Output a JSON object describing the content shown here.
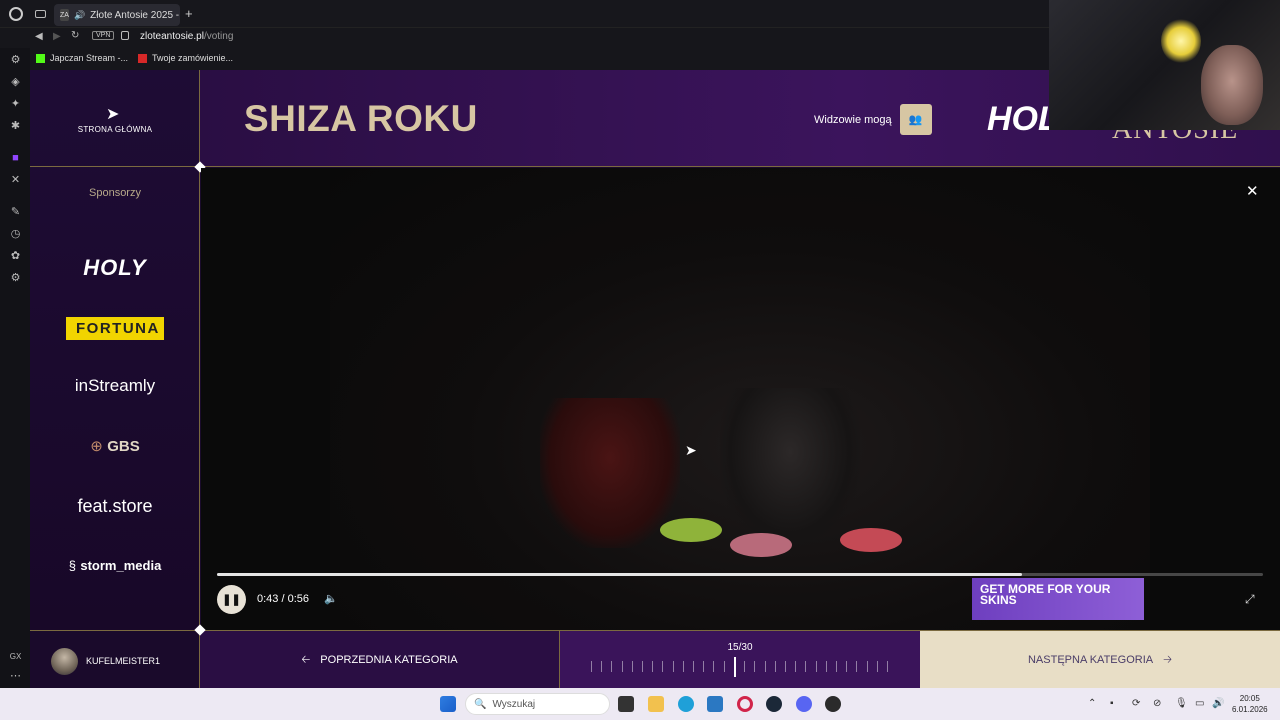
{
  "browser": {
    "tab_title": "Złote Antosie 2025 - N",
    "tab_favicon": "ZA",
    "vpn_label": "VPN",
    "url_domain": "zloteantosie.pl",
    "url_path": "/voting",
    "bookmarks": [
      "Japczan Stream -...",
      "Twoje zamówienie..."
    ],
    "rail_bottom_label": "GX"
  },
  "sidebar": {
    "home_label": "STRONA GŁÓWNA",
    "sponsors_title": "Sponsorzy",
    "sponsors": [
      "HOLY",
      "FORTUNA",
      "inStreamly",
      "GBS",
      "feat.store",
      "storm_media"
    ]
  },
  "header": {
    "title": "SHIZA ROKU",
    "viewers_label": "Widzowie mogą",
    "brand_left": "HOLY",
    "brand_right": "ANTOSIE"
  },
  "player": {
    "time": "0:43 / 0:56",
    "progress": 0.77,
    "ad_text": "GET MORE FOR YOUR SKINS"
  },
  "footer": {
    "username": "KUFELMEISTER1",
    "prev_label": "POPRZEDNIA KATEGORIA",
    "next_label": "NASTĘPNA KATEGORIA",
    "counter": "15/30",
    "current_index": 15,
    "total": 30
  },
  "taskbar": {
    "search_placeholder": "Wyszukaj",
    "time": "20:05",
    "date": "6.01.2026"
  },
  "colors": {
    "gold": "#d7c6a3",
    "purple_dark": "#1a0b2b",
    "purple_mid": "#2a0e43",
    "next_bg": "#e8dec6"
  }
}
